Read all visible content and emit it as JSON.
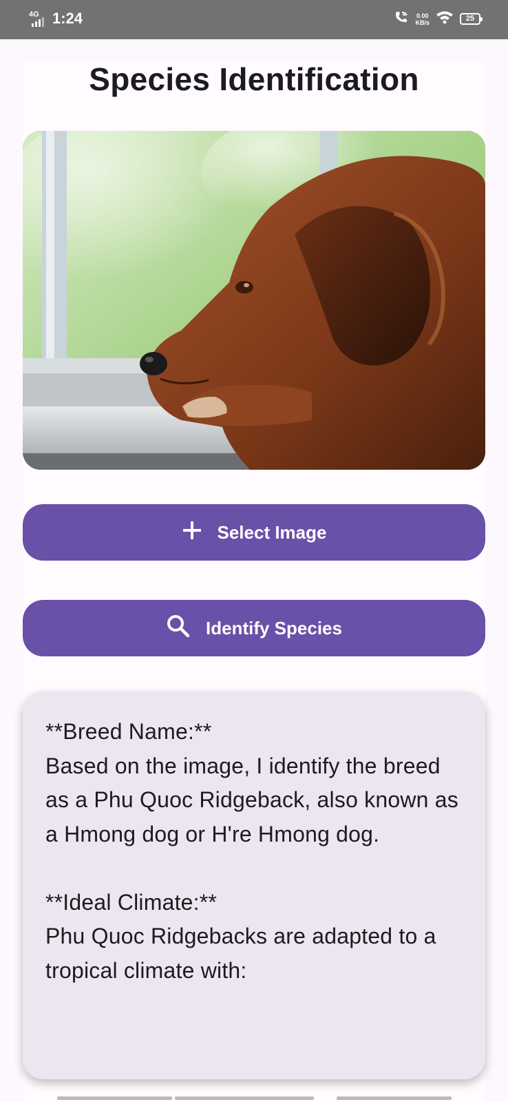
{
  "status_bar": {
    "network": "4G",
    "time": "1:24",
    "speed_value": "0.00",
    "speed_unit": "KB/s",
    "battery": "25",
    "icons": [
      "signal-icon",
      "wifi-call-icon",
      "wifi-icon",
      "battery-icon"
    ]
  },
  "page": {
    "title": "Species Identification"
  },
  "image_preview": {
    "subject": "brown dog resting head on window sill"
  },
  "buttons": {
    "select_image": {
      "label": "Select Image",
      "icon": "plus-icon"
    },
    "identify_species": {
      "label": "Identify Species",
      "icon": "search-icon"
    }
  },
  "result": {
    "text": "**Breed Name:**\nBased on the image, I identify the breed as a Phu Quoc Ridgeback, also known as a Hmong dog or H're Hmong dog.\n\n**Ideal Climate:**\nPhu Quoc Ridgebacks are adapted to a tropical climate with:"
  },
  "colors": {
    "status_bar": "#727272",
    "background": "#fdf8fd",
    "button": "#6950a8",
    "card": "#ece6f0",
    "text": "#1c1b1f"
  }
}
